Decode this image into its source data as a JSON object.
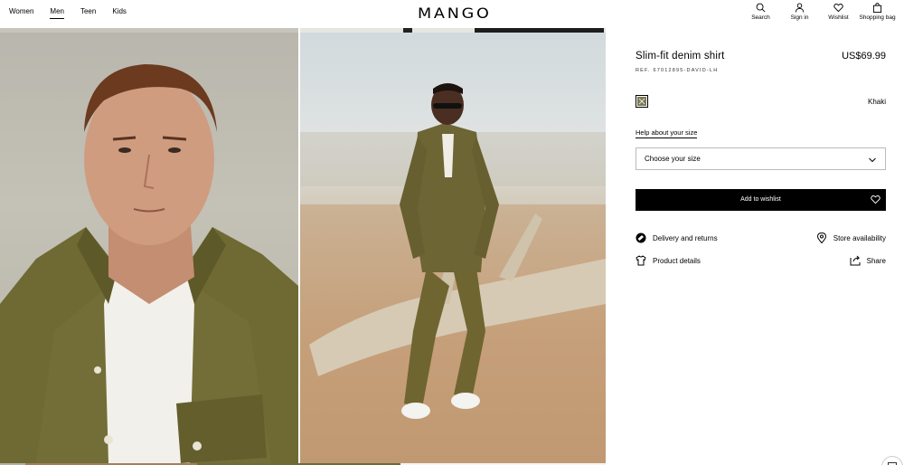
{
  "header": {
    "nav": [
      "Women",
      "Men",
      "Teen",
      "Kids"
    ],
    "active_nav": "Men",
    "logo": "MANGO",
    "tools": {
      "search": "Search",
      "signin": "Sign in",
      "wishlist": "Wishlist",
      "bag": "Shopping bag"
    }
  },
  "product": {
    "title": "Slim-fit denim shirt",
    "price": "US$69.99",
    "ref": "REF. 67012895-DAVID-LH",
    "color_name": "Khaki",
    "help_size": "Help about your size",
    "size_placeholder": "Choose your size",
    "add_button": "Add to wishlist",
    "links": {
      "delivery": "Delivery and returns",
      "store": "Store availability",
      "details": "Product details",
      "share": "Share"
    }
  },
  "colors": {
    "khaki": "#7d7a58",
    "accent": "#000000"
  }
}
